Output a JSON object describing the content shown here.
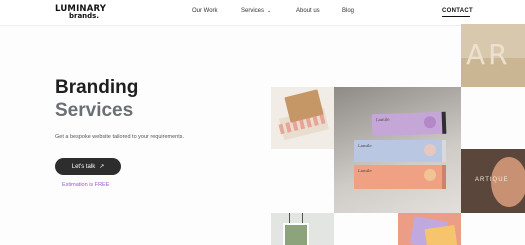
{
  "brand": {
    "name": "LUMINARY",
    "sub": "brands."
  },
  "nav": {
    "our_work": "Our Work",
    "services": "Services",
    "about": "About us",
    "blog": "Blog",
    "contact": "CONTACT"
  },
  "hero": {
    "title_line1": "Branding",
    "title_line2": "Services",
    "subtitle": "Get a bespoke website tailored to your requirements.",
    "cta_label": "Let's talk",
    "estimation": "Estimation is FREE"
  },
  "gallery": {
    "box_brand": "Lamile",
    "ar_text": "AR",
    "face_text": "ARTIQUE"
  },
  "colors": {
    "accent_purple": "#a15ad1",
    "button_dark": "#2d2d2d",
    "title_grey": "#6b6f73"
  }
}
